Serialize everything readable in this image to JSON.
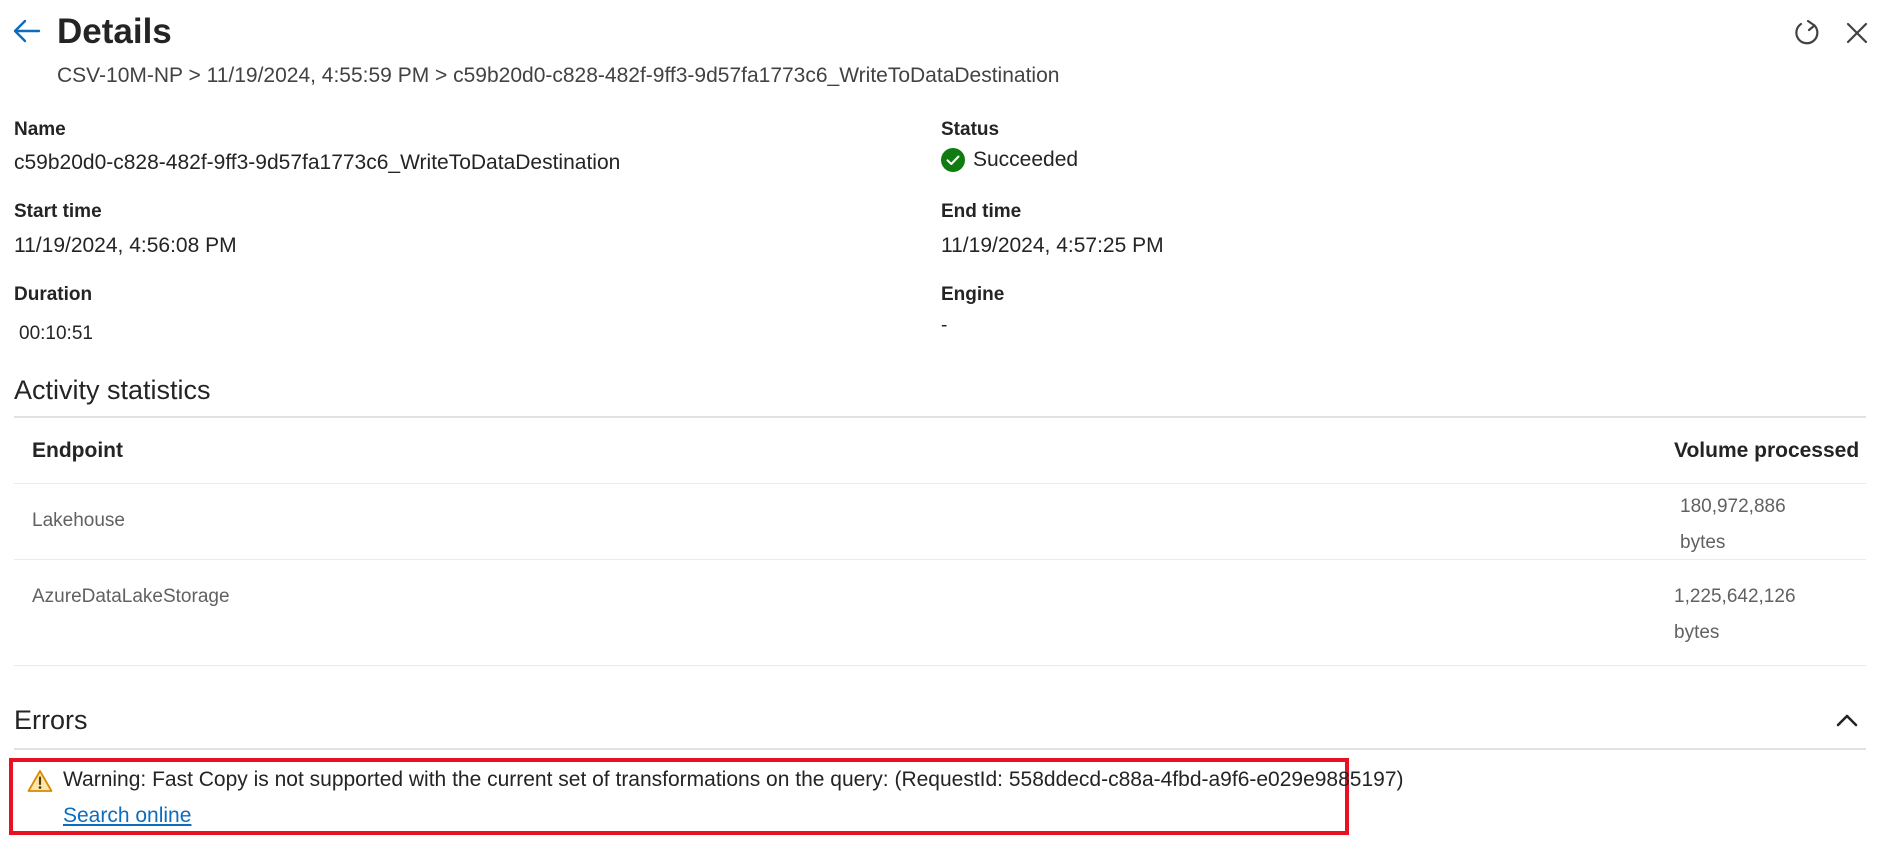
{
  "header": {
    "title": "Details",
    "breadcrumb": "CSV-10M-NP > 11/19/2024, 4:55:59 PM > c59b20d0-c828-482f-9ff3-9d57fa1773c6_WriteToDataDestination"
  },
  "fields": {
    "name_label": "Name",
    "name_value": "c59b20d0-c828-482f-9ff3-9d57fa1773c6_WriteToDataDestination",
    "status_label": "Status",
    "status_value": "Succeeded",
    "start_label": "Start time",
    "start_value": "11/19/2024, 4:56:08 PM",
    "end_label": "End time",
    "end_value": "11/19/2024, 4:57:25 PM",
    "duration_label": "Duration",
    "duration_value": "00:10:51",
    "engine_label": "Engine",
    "engine_value": "-"
  },
  "activity": {
    "title": "Activity statistics",
    "col_endpoint": "Endpoint",
    "col_volume": "Volume processed",
    "rows": [
      {
        "endpoint": "Lakehouse",
        "volume_value": "180,972,886",
        "volume_unit": "bytes"
      },
      {
        "endpoint": "AzureDataLakeStorage",
        "volume_value": "1,225,642,126",
        "volume_unit": "bytes"
      }
    ]
  },
  "errors": {
    "title": "Errors",
    "warning_text": "Warning: Fast Copy is not supported with the current set of transformations on the query: (RequestId: 558ddecd-c88a-4fbd-a9f6-e029e9885197)",
    "link_label": "Search online"
  },
  "colors": {
    "accent": "#0f6cbd",
    "success": "#107c10",
    "warning": "#f7a90a",
    "highlight_border": "#e81123"
  },
  "icons": {
    "back": "arrow-left-icon",
    "refresh": "refresh-icon",
    "close": "close-icon",
    "status": "checkmark-circle-icon",
    "collapse": "chevron-up-icon",
    "warning": "warning-triangle-icon"
  }
}
